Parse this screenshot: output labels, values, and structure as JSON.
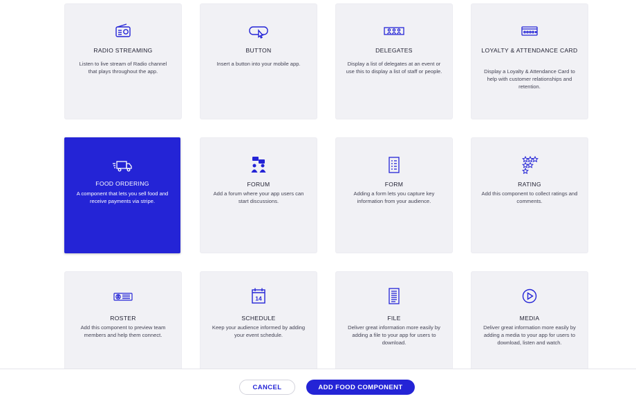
{
  "colors": {
    "accent": "#2424d6",
    "card_bg": "#f1f1f5",
    "icon": "#2424d6"
  },
  "cards": [
    {
      "title": "RADIO STREAMING",
      "desc": "Listen to live stream of Radio channel that plays throughout the app.",
      "icon": "radio-icon"
    },
    {
      "title": "BUTTON",
      "desc": "Insert a button into your mobile app.",
      "icon": "button-icon"
    },
    {
      "title": "DELEGATES",
      "desc": "Display a list of delegates at an event or use this to display a list of staff or people.",
      "icon": "delegates-icon"
    },
    {
      "title": "LOYALTY & ATTENDANCE CARD",
      "desc": "Display a Loyalty & Attendance Card to help with customer relationships and retention.",
      "icon": "loyalty-card-icon"
    },
    {
      "title": "FOOD ORDERING",
      "desc": "A component that lets you sell food and receive payments via stripe.",
      "icon": "delivery-truck-icon",
      "selected": true
    },
    {
      "title": "FORUM",
      "desc": "Add a forum where your app users can start discussions.",
      "icon": "forum-icon"
    },
    {
      "title": "FORM",
      "desc": "Adding a form lets you capture key information from your audience.",
      "icon": "form-icon"
    },
    {
      "title": "RATING",
      "desc": "Add this component to collect ratings and comments.",
      "icon": "rating-stars-icon"
    },
    {
      "title": "ROSTER",
      "desc": "Add this component to preview team members and help them connect.",
      "icon": "roster-icon"
    },
    {
      "title": "SCHEDULE",
      "desc": "Keep your audience informed by adding your event schedule.",
      "icon": "calendar-icon",
      "icon_text": "14"
    },
    {
      "title": "FILE",
      "desc": "Deliver great information more easily by adding a file to your app for users to download.",
      "icon": "file-icon"
    },
    {
      "title": "MEDIA",
      "desc": "Deliver great information more easily by adding a media to your app for users to download, listen and watch.",
      "icon": "play-icon"
    }
  ],
  "footer": {
    "cancel_label": "CANCEL",
    "primary_label": "ADD FOOD COMPONENT"
  }
}
